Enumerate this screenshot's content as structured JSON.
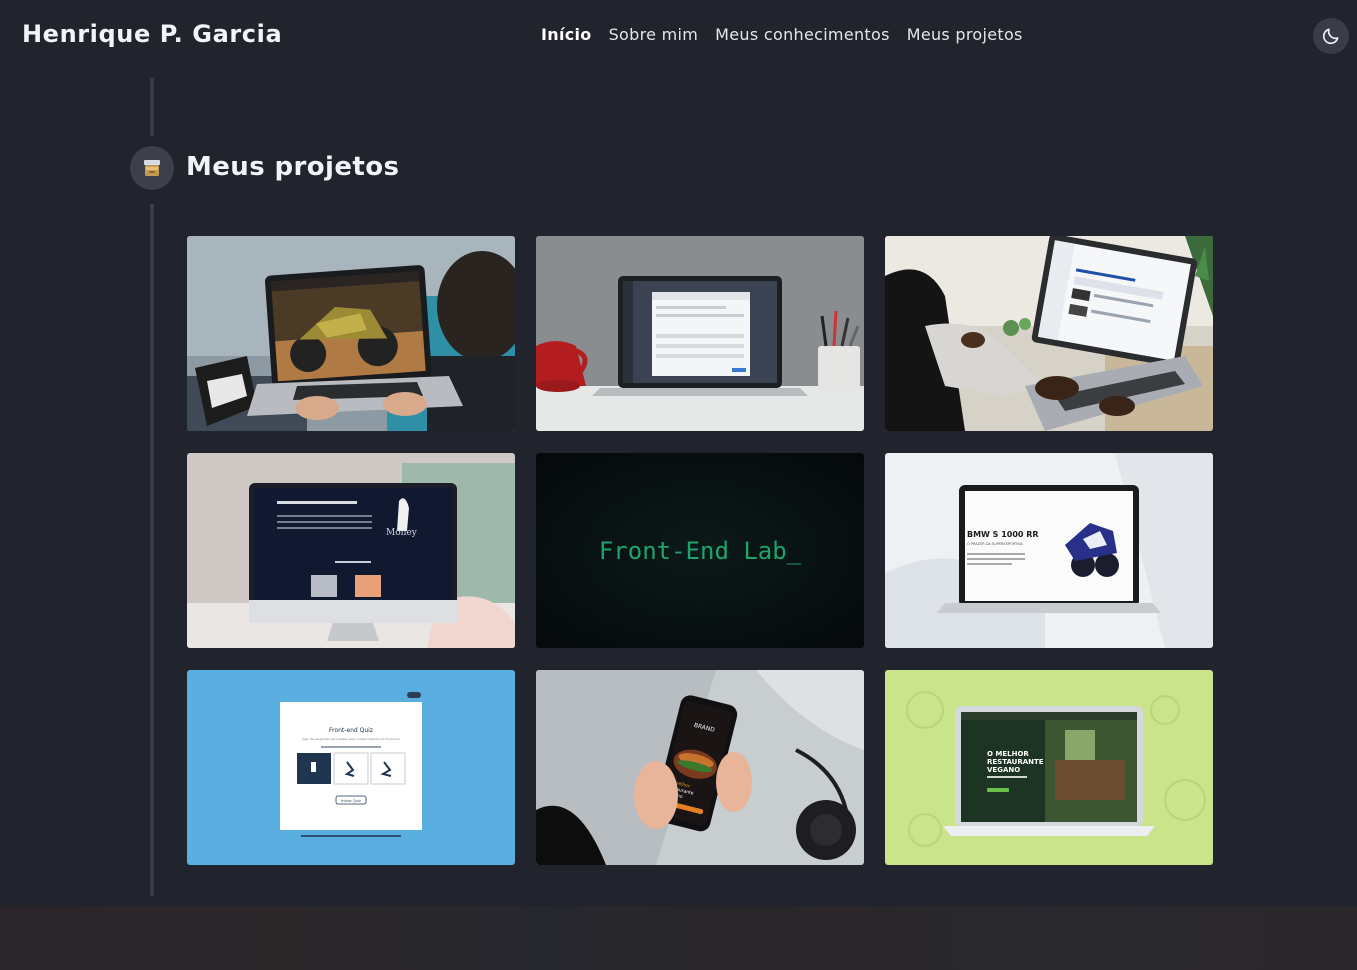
{
  "header": {
    "brand": "Henrique P. Garcia",
    "nav": [
      "Início",
      "Sobre mim",
      "Meus conhecimentos",
      "Meus projetos"
    ],
    "active_nav": "Início",
    "theme_icon": "moon-icon"
  },
  "section": {
    "title": "Meus projetos",
    "icon": "card-file-box-icon"
  },
  "projects": {
    "card2_overlay": "Front-End Lab_",
    "card5_heading": "BMW S 1000 RR",
    "card5_sub": "O PRAZER DA SUPERESPORTIVA",
    "card6_heading": "Front-end Quiz",
    "card6_sub": "Jogo de perguntas para testar seus conhecimentos em front-end",
    "card6_button": "Iniciar Quiz",
    "card7_brand": "BRAND",
    "card7_line1": "O melhor",
    "card7_line2": "restaurante",
    "card7_line3": "Vegano",
    "card8_heading1": "O MELHOR",
    "card8_heading2": "RESTAURANTE",
    "card8_heading3": "VEGANO",
    "card3_logo": "Money"
  },
  "colors": {
    "background": "#22242d",
    "accent_green": "#1ec27c",
    "quiz_blue": "#5aaee0",
    "vegan_green": "#c9e48a"
  }
}
